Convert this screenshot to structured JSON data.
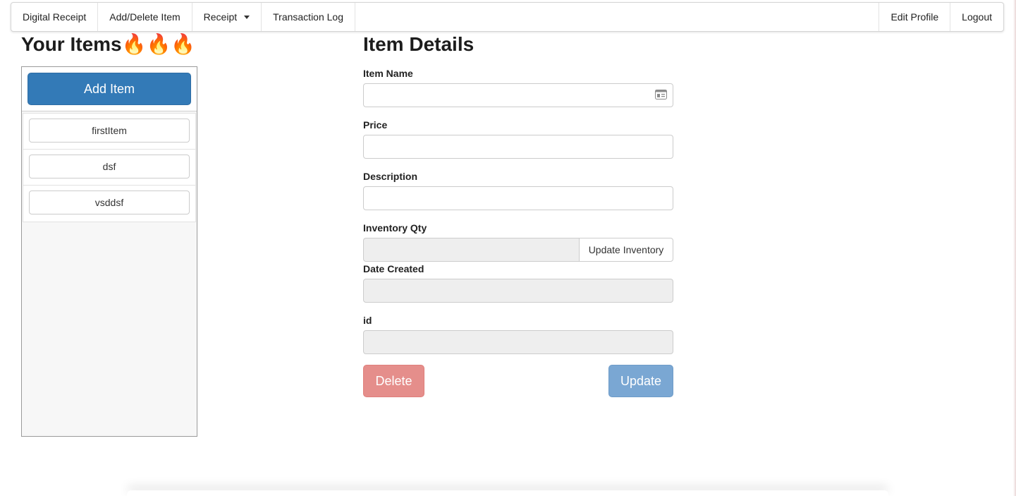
{
  "nav": {
    "left": [
      {
        "label": "Digital Receipt"
      },
      {
        "label": "Add/Delete Item"
      },
      {
        "label": "Receipt"
      },
      {
        "label": "Transaction Log"
      }
    ],
    "right": [
      {
        "label": "Edit Profile"
      },
      {
        "label": "Logout"
      }
    ]
  },
  "items_panel": {
    "title": "Your Items🔥🔥🔥",
    "add_button": "Add Item",
    "items": [
      "firstItem",
      "dsf",
      "vsddsf"
    ]
  },
  "details": {
    "title": "Item Details",
    "item_name": {
      "label": "Item Name",
      "value": ""
    },
    "price": {
      "label": "Price",
      "value": ""
    },
    "description": {
      "label": "Description",
      "value": ""
    },
    "inventory_qty": {
      "label": "Inventory Qty",
      "value": "",
      "button": "Update Inventory"
    },
    "date_created": {
      "label": "Date Created",
      "value": ""
    },
    "id": {
      "label": "id",
      "value": ""
    },
    "delete_button": "Delete",
    "update_button": "Update"
  },
  "colors": {
    "primary": "#337ab7",
    "delete_disabled": "#e58e8b",
    "update_disabled": "#7aa7d3",
    "readonly_bg": "#eeeeee"
  },
  "icons": {
    "item_name_field": "contact-card-icon",
    "receipt_menu": "caret-down-icon"
  }
}
